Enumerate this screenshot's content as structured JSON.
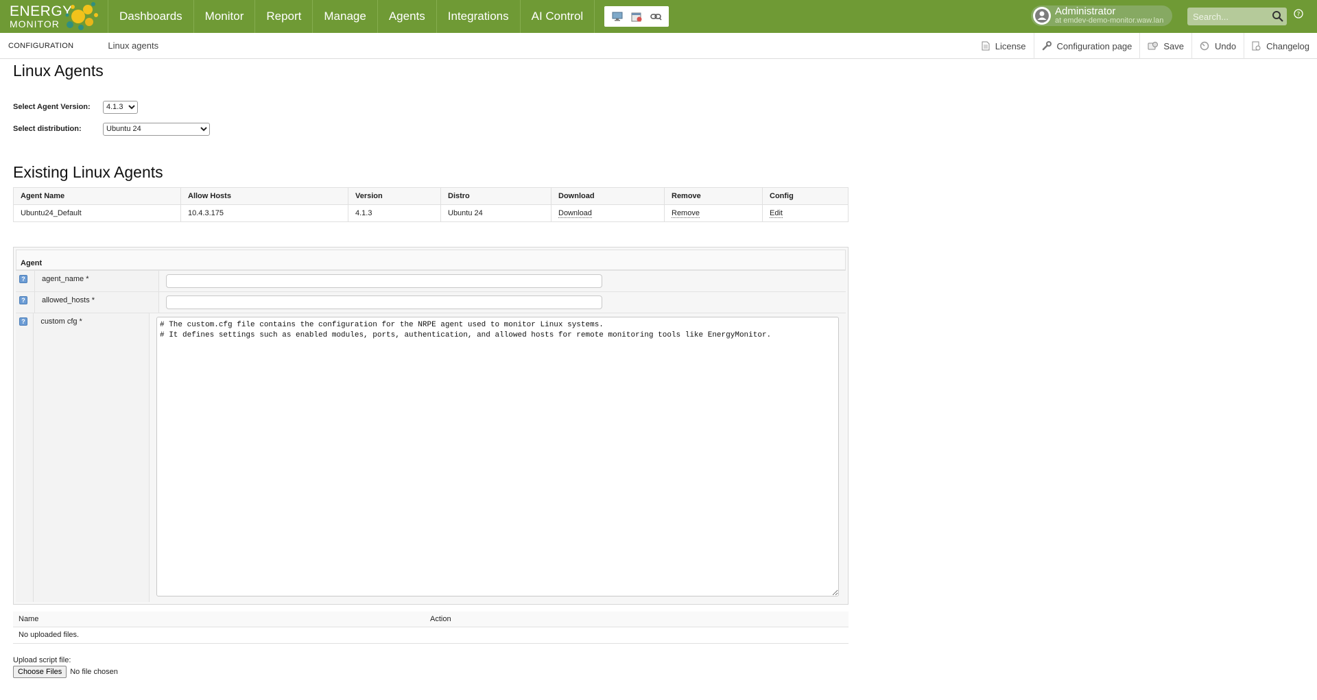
{
  "logo": {
    "line1": "ENERGY",
    "line2": "MONITOR"
  },
  "nav": [
    "Dashboards",
    "Monitor",
    "Report",
    "Manage",
    "Agents",
    "Integrations",
    "AI Control"
  ],
  "quick_tools": [
    "monitor-icon",
    "calendar-icon",
    "link-icon"
  ],
  "user": {
    "name": "Administrator",
    "host": "at emdev-demo-monitor.waw.lan"
  },
  "search": {
    "placeholder": "Search..."
  },
  "subbar": {
    "section": "CONFIGURATION",
    "crumb": "Linux agents",
    "actions": {
      "license": "License",
      "config_page": "Configuration page",
      "save": "Save",
      "undo": "Undo",
      "changelog": "Changelog"
    }
  },
  "page": {
    "title": "Linux Agents",
    "version_label": "Select Agent Version:",
    "version_value": "4.1.3",
    "distro_label": "Select distribution:",
    "distro_value": "Ubuntu 24",
    "existing_title": "Existing Linux Agents"
  },
  "agents_table": {
    "headers": [
      "Agent Name",
      "Allow Hosts",
      "Version",
      "Distro",
      "Download",
      "Remove",
      "Config"
    ],
    "rows": [
      {
        "name": "Ubuntu24_Default",
        "hosts": "10.4.3.175",
        "version": "4.1.3",
        "distro": "Ubuntu 24",
        "download": "Download",
        "remove": "Remove",
        "config": "Edit"
      }
    ]
  },
  "agent_form": {
    "title": "Agent",
    "fields": [
      {
        "label": "agent_name *",
        "value": ""
      },
      {
        "label": "allowed_hosts *",
        "value": ""
      },
      {
        "label": "custom cfg *",
        "value": "# The custom.cfg file contains the configuration for the NRPE agent used to monitor Linux systems.\n# It defines settings such as enabled modules, ports, authentication, and allowed hosts for remote monitoring tools like EnergyMonitor."
      }
    ]
  },
  "files_table": {
    "headers": [
      "Name",
      "Action"
    ],
    "empty": "No uploaded files."
  },
  "upload": {
    "label": "Upload script file:",
    "button": "Choose Files",
    "status": "No file chosen"
  },
  "colors": {
    "topbar": "#6f9a35",
    "accent": "#86a962"
  }
}
